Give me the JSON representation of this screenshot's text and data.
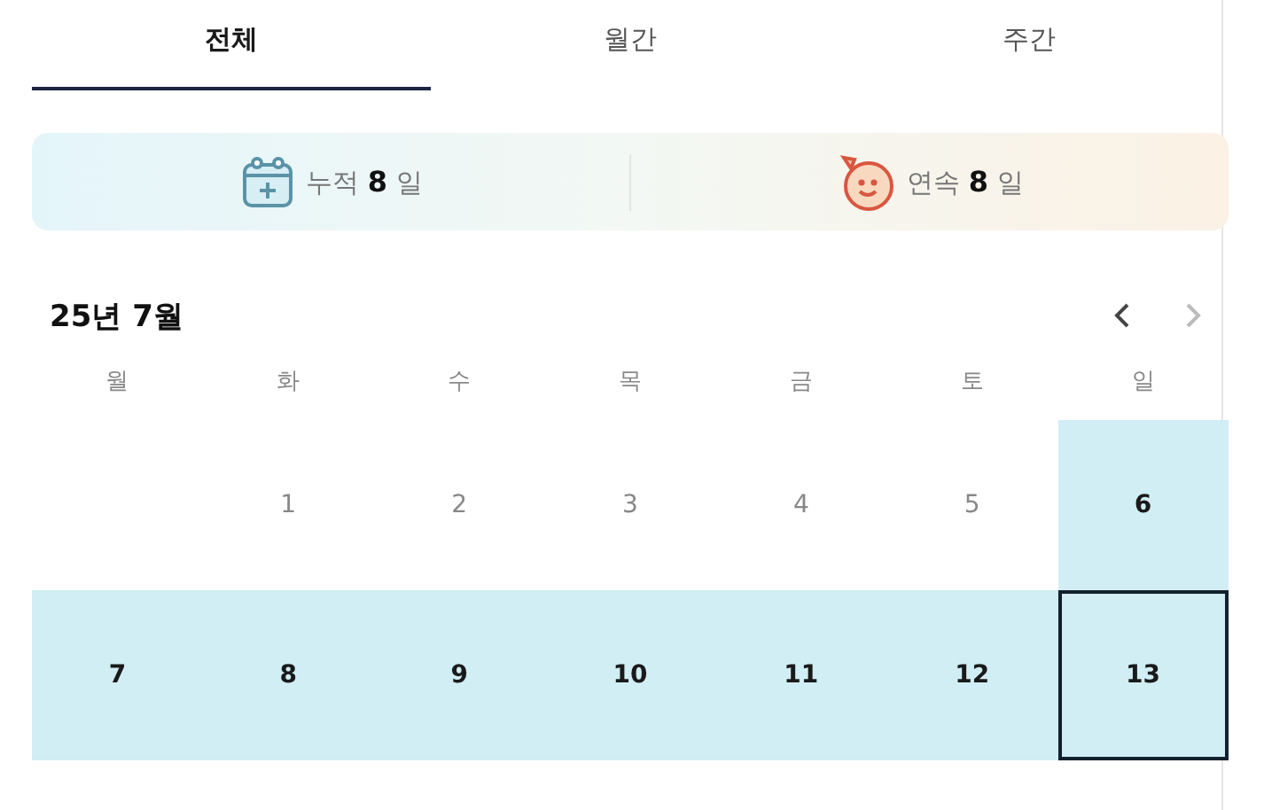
{
  "tabs": [
    {
      "label": "전체",
      "selected": true
    },
    {
      "label": "월간",
      "selected": false
    },
    {
      "label": "주간",
      "selected": false
    }
  ],
  "stats": [
    {
      "kind": "calendar",
      "text": "누적 **8** 일"
    },
    {
      "kind": "face",
      "text": "연속 **8** 일"
    }
  ],
  "calendar": {
    "title": "25년 7월",
    "prev_disabled": false,
    "next_disabled": true,
    "weekdays": [
      "월",
      "화",
      "수",
      "목",
      "금",
      "토",
      "일"
    ],
    "weeks": [
      [
        {
          "kind": "empty"
        },
        {
          "kind": "day",
          "day": "1",
          "marked": false,
          "today": false
        },
        {
          "kind": "day",
          "day": "2",
          "marked": false,
          "today": false
        },
        {
          "kind": "day",
          "day": "3",
          "marked": false,
          "today": false
        },
        {
          "kind": "day",
          "day": "4",
          "marked": false,
          "today": false
        },
        {
          "kind": "day",
          "day": "5",
          "marked": false,
          "today": false
        },
        {
          "kind": "day",
          "day": "6",
          "marked": true,
          "today": false
        }
      ],
      [
        {
          "kind": "day",
          "day": "7",
          "marked": true,
          "today": false
        },
        {
          "kind": "day",
          "day": "8",
          "marked": true,
          "today": false
        },
        {
          "kind": "day",
          "day": "9",
          "marked": true,
          "today": false
        },
        {
          "kind": "day",
          "day": "10",
          "marked": true,
          "today": false
        },
        {
          "kind": "day",
          "day": "11",
          "marked": true,
          "today": false
        },
        {
          "kind": "day",
          "day": "12",
          "marked": true,
          "today": false
        },
        {
          "kind": "day",
          "day": "13",
          "marked": true,
          "today": true
        }
      ]
    ]
  }
}
